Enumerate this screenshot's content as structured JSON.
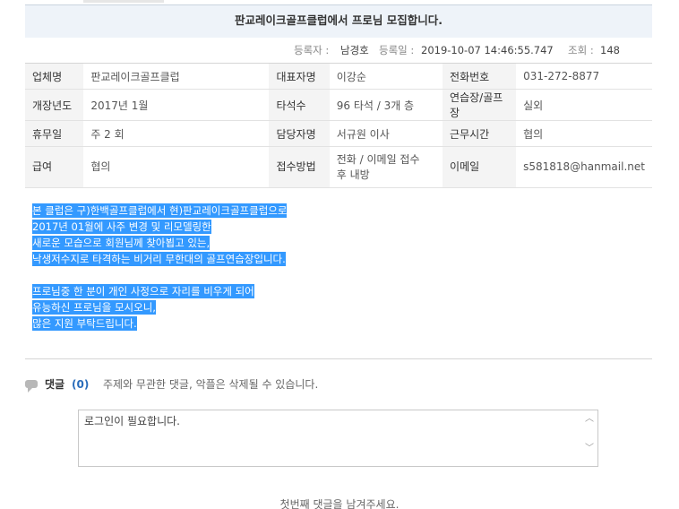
{
  "post": {
    "title": "판교레이크골프클럽에서 프로님 모집합니다.",
    "author_label": "등록자 :",
    "author": "남경호",
    "date_label": "등록일 :",
    "date": "2019-10-07 14:46:55.747",
    "views_label": "조회 :",
    "views": "148"
  },
  "info": {
    "company_label": "업체명",
    "company": "판교레이크골프클럽",
    "ceo_label": "대표자명",
    "ceo": "이강순",
    "phone_label": "전화번호",
    "phone": "031-272-8877",
    "opened_label": "개장년도",
    "opened": "2017년 1월",
    "bays_label": "타석수",
    "bays": "96 타석 / 3개 층",
    "range_label": "연습장/골프장",
    "range": "실외",
    "holiday_label": "휴무일",
    "holiday": "주 2 회",
    "manager_label": "담당자명",
    "manager": "서규원 이사",
    "hours_label": "근무시간",
    "hours": "협의",
    "salary_label": "급여",
    "salary": "협의",
    "apply_label": "접수방법",
    "apply_line1": "전화 / 이메일 접수",
    "apply_line2": "후 내방",
    "email_label": "이메일",
    "email": "s581818@hanmail.net"
  },
  "content": {
    "lines": [
      "본 클럽은 구)한백골프클럽에서 현)판교레이크골프클럽으로",
      "2017년 01월에 사주 변경 및 리모델링한",
      "새로운 모습으로 회원님께 찾아뵙고 있는,",
      "낙생저수지로 타격하는 비거리 무한대의 골프연습장입니다.",
      "프로님중 한 분이 개인 사정으로 자리를 비우게 되어",
      "유능하신 프로님을 모시오니,",
      "많은 지원 부탁드립니다."
    ]
  },
  "comments": {
    "title": "댓글",
    "count": "(0)",
    "notice": "주제와 무관한 댓글, 악플은 삭제될 수 있습니다.",
    "input_value": "로그인이 필요합니다.",
    "empty_message": "첫번째 댓글을 남겨주세요."
  },
  "colors": {
    "selection": "#3399ff",
    "title_bg": "#eef3f9",
    "count": "#2a6dbb"
  }
}
